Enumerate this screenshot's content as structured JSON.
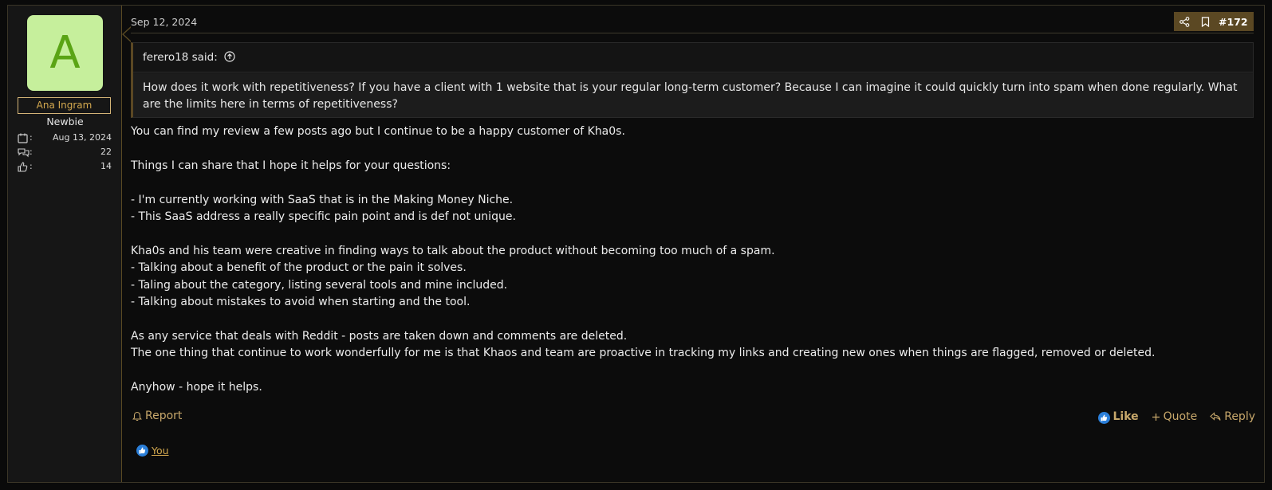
{
  "user": {
    "avatar_letter": "A",
    "name": "Ana Ingram",
    "title": "Newbie",
    "stats": [
      {
        "icon": "calendar-icon",
        "value": "Aug 13, 2024"
      },
      {
        "icon": "messages-icon",
        "value": "22"
      },
      {
        "icon": "thumbs-up-icon",
        "value": "14"
      }
    ],
    "stat_colon": ":"
  },
  "post": {
    "date": "Sep 12, 2024",
    "number": "#172",
    "quote": {
      "author": "ferero18 said:",
      "text": "How does it work with repetitiveness? If you have a client with 1 website that is your regular long-term customer? Because I can imagine it could quickly turn into spam when done regularly. What are the limits here in terms of repetitiveness?"
    },
    "paragraphs": [
      "You can find my review a few posts ago but I continue to be a happy customer of Kha0s.",
      "",
      "Things I can share that I hope it helps for your questions:",
      "",
      "- I'm currently working with SaaS that is in the Making Money Niche.",
      "- This SaaS address a really specific pain point and is def not unique.",
      "",
      "Kha0s and his team were creative in finding ways to talk about the product without becoming too much of a spam.",
      "- Talking about a benefit of the product or the pain it solves.",
      "- Taling about the category, listing several tools and mine included.",
      "- Talking about mistakes to avoid when starting and the tool.",
      "",
      "As any service that deals with Reddit - posts are taken down and comments are deleted.",
      "The one thing that continue to work wonderfully for me is that Khaos and team are proactive in tracking my links and creating new ones when things are flagged, removed or deleted.",
      "",
      "Anyhow - hope it helps."
    ]
  },
  "actions": {
    "report": "Report",
    "like": "Like",
    "quote": "Quote",
    "reply": "Reply"
  },
  "reactions": {
    "you": "You"
  },
  "colors": {
    "accent": "#c8a86b",
    "toolbar_bg": "#5b4823",
    "avatar_bg": "#c6ef9c",
    "avatar_fg": "#5aa415",
    "like_blue": "#2b7fd9"
  }
}
